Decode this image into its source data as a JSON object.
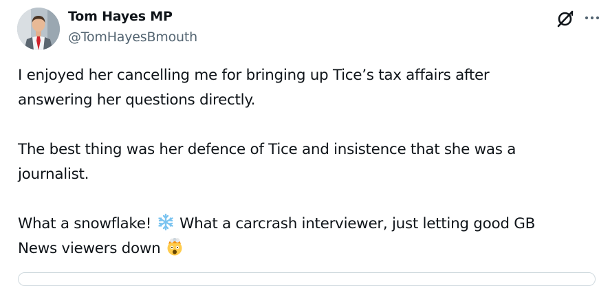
{
  "tweet": {
    "author": {
      "display_name": "Tom Hayes MP",
      "handle": "@TomHayesBmouth",
      "avatar_icon": "profile-photo"
    },
    "actions": {
      "grok_icon": "grok-icon",
      "more_icon": "more-options-icon"
    },
    "paragraphs": [
      {
        "line1": "I enjoyed her cancelling me for bringing up Tice’s tax affairs after",
        "line2": "answering her questions directly."
      },
      {
        "line1": "The best thing was her defence of Tice and insistence that she was a",
        "line2": "journalist."
      },
      {
        "line1_before_emoji": "What a snowflake!",
        "line1_after_emoji": "What a carcrash interviewer, just letting good GB",
        "line2": "News viewers down",
        "emoji_1": "snowflake-emoji",
        "emoji_2": "exploding-head-emoji"
      }
    ]
  },
  "colors": {
    "text_primary": "#0f1419",
    "text_secondary": "#536471",
    "border": "#cfd9de",
    "snowflake": "#7cc4f0",
    "emoji_face": "#ffcc4d"
  }
}
